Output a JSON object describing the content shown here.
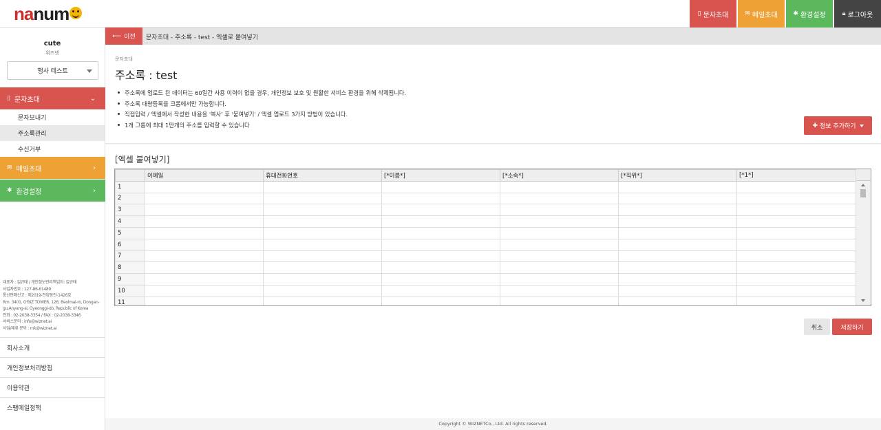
{
  "brand": {
    "logo_part1": "na",
    "logo_part2": "num"
  },
  "topnav": [
    {
      "label": "문자초대",
      "icon": "mobile-icon"
    },
    {
      "label": "메일초대",
      "icon": "envelope-icon"
    },
    {
      "label": "환경설정",
      "icon": "gear-icon"
    },
    {
      "label": "로그아웃",
      "icon": "lock-icon"
    }
  ],
  "user": {
    "name": "cute",
    "id": "위즈넷"
  },
  "event_select": {
    "selected": "행사 테스트"
  },
  "sidebar": {
    "sms": {
      "label": "문자초대",
      "subitems": [
        "문자보내기",
        "주소록관리",
        "수신거부"
      ],
      "active_index": 1
    },
    "mail": {
      "label": "메일초대"
    },
    "settings": {
      "label": "환경설정"
    }
  },
  "company_info": [
    "대표자 : 김규태 / 개인정보관리책임자: 김규태",
    "사업자번호 : 127-86-61489",
    "통신판매신고 : 제2019-안양동안-1426호",
    "Rm. 3401, O'BIZ TOWER, 126, Beolmal-ro, Dongan-gu,Anyang-si, Gyeonggi-do, Republic of Korea",
    "전화 : 02-2038-3354 / FAX : 02-2038-3346",
    "서비스문의 : info@wiznet.ai",
    "사업/제휴 문의 : mk@wiznet.ai"
  ],
  "footer_links": [
    "회사소개",
    "개인정보처리방침",
    "이용약관",
    "스팸메일정책"
  ],
  "breadcrumb": {
    "back_label": "이전",
    "path": "문자초대 - 주소록 - test - 엑셀로 붙여넣기"
  },
  "page": {
    "small_label": "문자초대",
    "title": "주소록 : test",
    "notes": [
      "주소록에 업로드 된 데이터는 60일간 사용 이력이 없을 경우, 개인정보 보호 및 원활한 서비스 환경을 위해 삭제됩니다.",
      "주소록 대량등록을 크롬에서만 가능합니다.",
      "직접입력 / 엑셀에서 작성한 내용을 '복사' 후 '붙여넣기' / 엑셀 업로드 3가지 방법이 있습니다.",
      "1개 그룹에 최대 1만개의 주소를 입력할 수 있습니다"
    ],
    "add_info_label": "정보 추가하기"
  },
  "paste_section": {
    "title": "[엑셀 붙여넣기]",
    "columns": [
      "이메일",
      "휴대전화번호",
      "[*이름*]",
      "[*소속*]",
      "[*직위*]",
      "[*1*]"
    ],
    "row_numbers": [
      "1",
      "2",
      "3",
      "4",
      "5",
      "6",
      "7",
      "8",
      "9",
      "10",
      "11"
    ]
  },
  "actions": {
    "cancel": "취소",
    "save": "저장하기"
  },
  "footer": {
    "copyright": "Copyright © WIZNETCo., Ltd. All rights reserved."
  },
  "colors": {
    "red": "#d9534f",
    "orange": "#eea236",
    "green": "#5cb85c",
    "dark": "#444444"
  }
}
